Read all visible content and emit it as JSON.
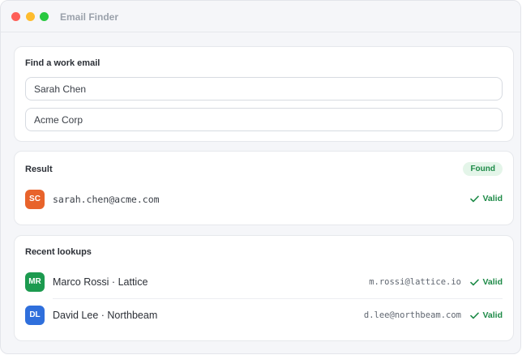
{
  "window": {
    "title": "Email Finder",
    "traffic_lights": [
      "close",
      "minimize",
      "maximize"
    ]
  },
  "finder": {
    "heading": "Find a work email",
    "name_value": "Sarah Chen",
    "company_value": "Acme Corp"
  },
  "result": {
    "heading": "Result",
    "badge": "Found",
    "avatar_initials": "SC",
    "avatar_color": "#e8632b",
    "email": "sarah.chen@acme.com",
    "status": "Valid",
    "status_icon": "check-icon"
  },
  "recent": {
    "heading": "Recent lookups",
    "items": [
      {
        "initials": "MR",
        "avatar_color": "#1c9a4f",
        "name": "Marco Rossi · Lattice",
        "email": "m.rossi@lattice.io",
        "status": "Valid"
      },
      {
        "initials": "DL",
        "avatar_color": "#2f6fdc",
        "name": "David Lee · Northbeam",
        "email": "d.lee@northbeam.com",
        "status": "Valid"
      }
    ]
  },
  "colors": {
    "accent_green": "#1d8a47",
    "badge_bg": "#e4f5e9"
  }
}
